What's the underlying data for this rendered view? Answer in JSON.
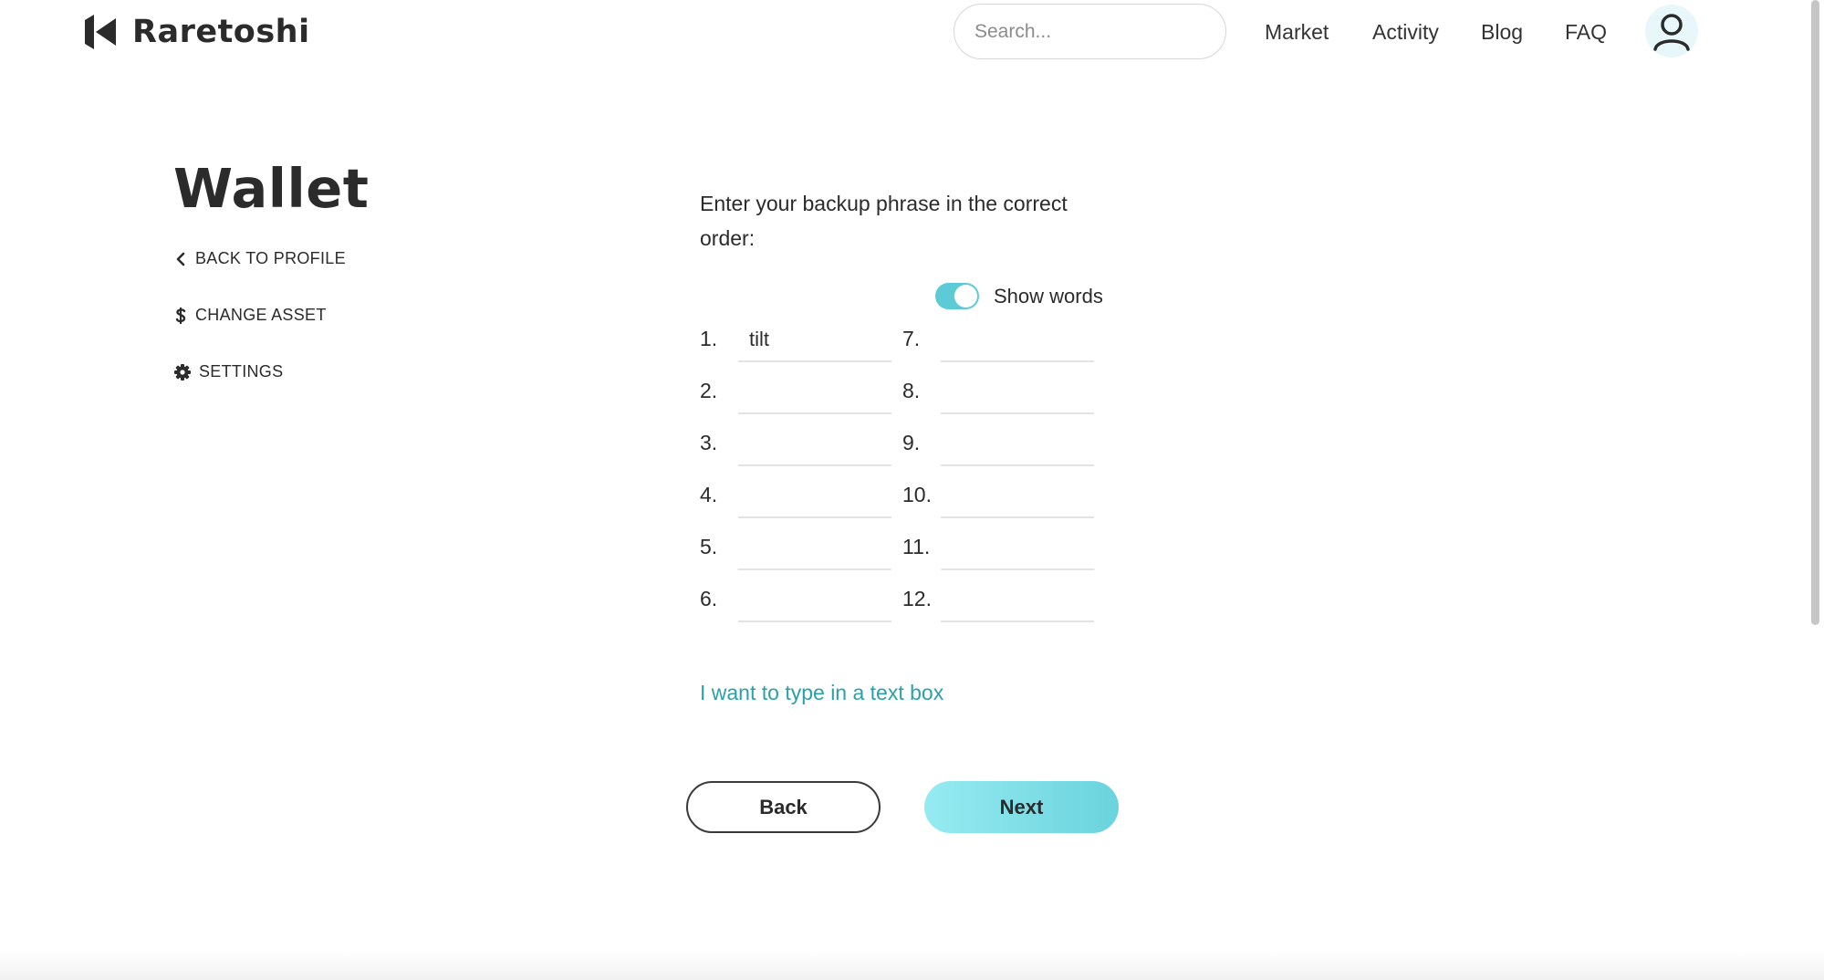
{
  "brand": {
    "name": "Raretoshi"
  },
  "search": {
    "placeholder": "Search..."
  },
  "nav": [
    "Market",
    "Activity",
    "Blog",
    "FAQ"
  ],
  "sidebar": {
    "title": "Wallet",
    "items": [
      {
        "label": "BACK TO PROFILE",
        "icon": "chevron-left-icon"
      },
      {
        "label": "CHANGE ASSET",
        "icon": "dollar-icon"
      },
      {
        "label": "SETTINGS",
        "icon": "gear-icon"
      }
    ]
  },
  "main": {
    "instruction": "Enter your backup phrase in the correct order:",
    "toggle": {
      "label": "Show words",
      "on": true
    },
    "words": [
      {
        "num": "1.",
        "value": "tilt"
      },
      {
        "num": "2.",
        "value": ""
      },
      {
        "num": "3.",
        "value": ""
      },
      {
        "num": "4.",
        "value": ""
      },
      {
        "num": "5.",
        "value": ""
      },
      {
        "num": "6.",
        "value": ""
      },
      {
        "num": "7.",
        "value": ""
      },
      {
        "num": "8.",
        "value": ""
      },
      {
        "num": "9.",
        "value": ""
      },
      {
        "num": "10.",
        "value": ""
      },
      {
        "num": "11.",
        "value": ""
      },
      {
        "num": "12.",
        "value": ""
      }
    ],
    "text_box_link": "I want to type in a text box",
    "back_label": "Back",
    "next_label": "Next"
  },
  "colors": {
    "accent": "#5ccbd6",
    "link": "#2aa1aa",
    "text": "#2b2b2b"
  }
}
